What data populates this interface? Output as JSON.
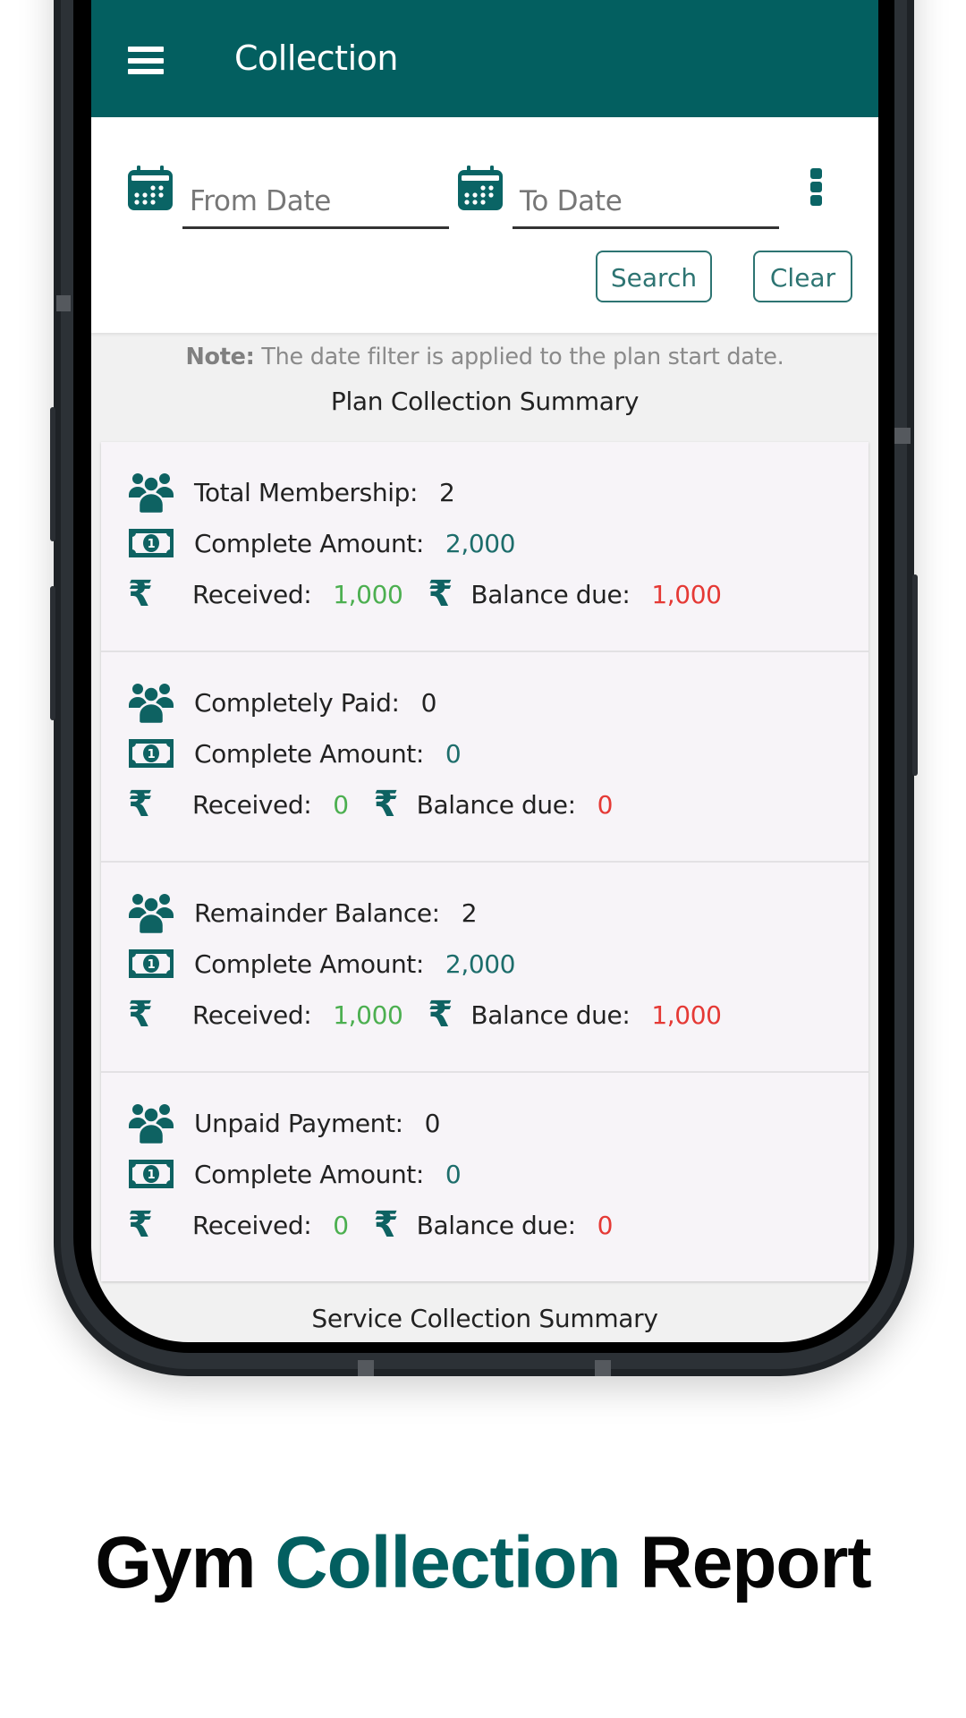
{
  "app_bar": {
    "title": "Collection",
    "menu_icon": "hamburger-menu-icon"
  },
  "filter": {
    "from_date": {
      "placeholder": "From Date",
      "value": "",
      "icon": "calendar-icon"
    },
    "to_date": {
      "placeholder": "To Date",
      "value": "",
      "icon": "calendar-icon"
    },
    "more_icon": "more-vertical-icon",
    "search_label": "Search",
    "clear_label": "Clear"
  },
  "note": {
    "prefix": "Note:",
    "text": " The date filter is applied to the plan start date."
  },
  "plan_summary": {
    "title": "Plan Collection Summary",
    "cards": [
      {
        "count_label": "Total Membership:",
        "count": "2",
        "amount_label": "Complete Amount:",
        "amount": "2,000",
        "received_label": "Received:",
        "received": "1,000",
        "balance_label": "Balance due:",
        "balance": "1,000"
      },
      {
        "count_label": "Completely Paid:",
        "count": "0",
        "amount_label": "Complete Amount:",
        "amount": "0",
        "received_label": "Received:",
        "received": "0",
        "balance_label": "Balance due:",
        "balance": "0"
      },
      {
        "count_label": "Remainder Balance:",
        "count": "2",
        "amount_label": "Complete Amount:",
        "amount": "2,000",
        "received_label": "Received:",
        "received": "1,000",
        "balance_label": "Balance due:",
        "balance": "1,000"
      },
      {
        "count_label": "Unpaid Payment:",
        "count": "0",
        "amount_label": "Complete Amount:",
        "amount": "0",
        "received_label": "Received:",
        "received": "0",
        "balance_label": "Balance due:",
        "balance": "0"
      }
    ]
  },
  "service_summary": {
    "title": "Service Collection Summary"
  },
  "marketing": {
    "word1": "Gym",
    "word2": "Collection",
    "word3": "Report"
  },
  "colors": {
    "primary": "#035f60",
    "amount": "#1d6d6b",
    "received": "#4caf50",
    "balance": "#e53935"
  },
  "icons": {
    "rupee_glyph": "₹"
  }
}
